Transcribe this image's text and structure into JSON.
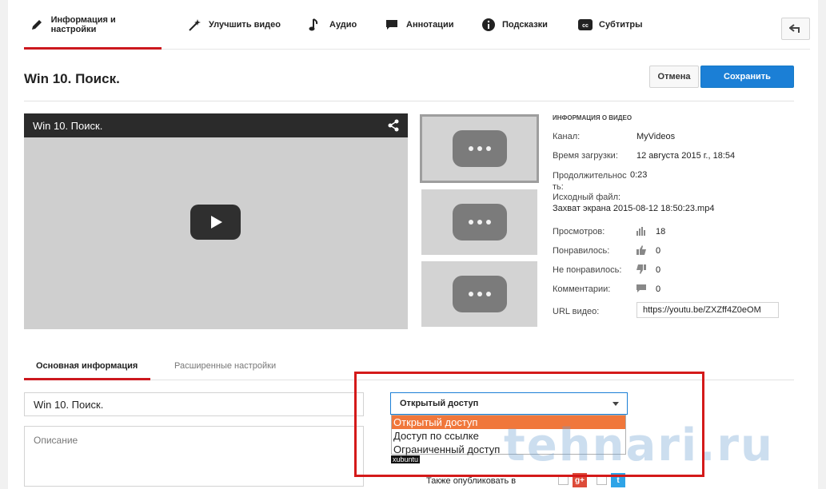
{
  "tabs": [
    {
      "label": "Информация и настройки",
      "icon": "pencil-icon",
      "active": true
    },
    {
      "label": "Улучшить видео",
      "icon": "magic-wand-icon"
    },
    {
      "label": "Аудио",
      "icon": "music-note-icon"
    },
    {
      "label": "Аннотации",
      "icon": "speech-bubble-icon"
    },
    {
      "label": "Подсказки",
      "icon": "info-icon"
    },
    {
      "label": "Субтитры",
      "icon": "cc-icon"
    }
  ],
  "header": {
    "title": "Win 10. Поиск.",
    "cancel_label": "Отмена",
    "save_label": "Сохранить"
  },
  "player": {
    "title": "Win 10. Поиск."
  },
  "video_info": {
    "heading": "ИНФОРМАЦИЯ О ВИДЕО",
    "channel_label": "Канал:",
    "channel": "MyVideos",
    "upload_label": "Время загрузки:",
    "upload": "12 августа 2015 г., 18:54",
    "duration_label": "Продолжительность:",
    "duration": "0:23",
    "source_label": "Исходный файл:",
    "source": "Захват экрана 2015-08-12 18:50:23.mp4",
    "views_label": "Просмотров:",
    "views": "18",
    "likes_label": "Понравилось:",
    "likes": "0",
    "dislikes_label": "Не понравилось:",
    "dislikes": "0",
    "comments_label": "Комментарии:",
    "comments": "0",
    "url_label": "URL видео:",
    "url": "https://youtu.be/ZXZff4Z0eOM"
  },
  "subtabs": {
    "basic": "Основная информация",
    "advanced": "Расширенные настройки"
  },
  "form": {
    "title_value": "Win 10. Поиск.",
    "description_placeholder": "Описание",
    "privacy_selected": "Открытый доступ",
    "privacy_options": [
      "Открытый доступ",
      "Доступ по ссылке",
      "Ограниченный доступ"
    ],
    "publish_label": "Также опубликовать в"
  },
  "overlay": {
    "tag": "xubuntu",
    "watermark": "tehnari.ru"
  },
  "colors": {
    "accent_red": "#cc181e",
    "save_blue": "#1b7fd6",
    "highlight": "#f0773b",
    "annotation": "#d41a1a"
  }
}
